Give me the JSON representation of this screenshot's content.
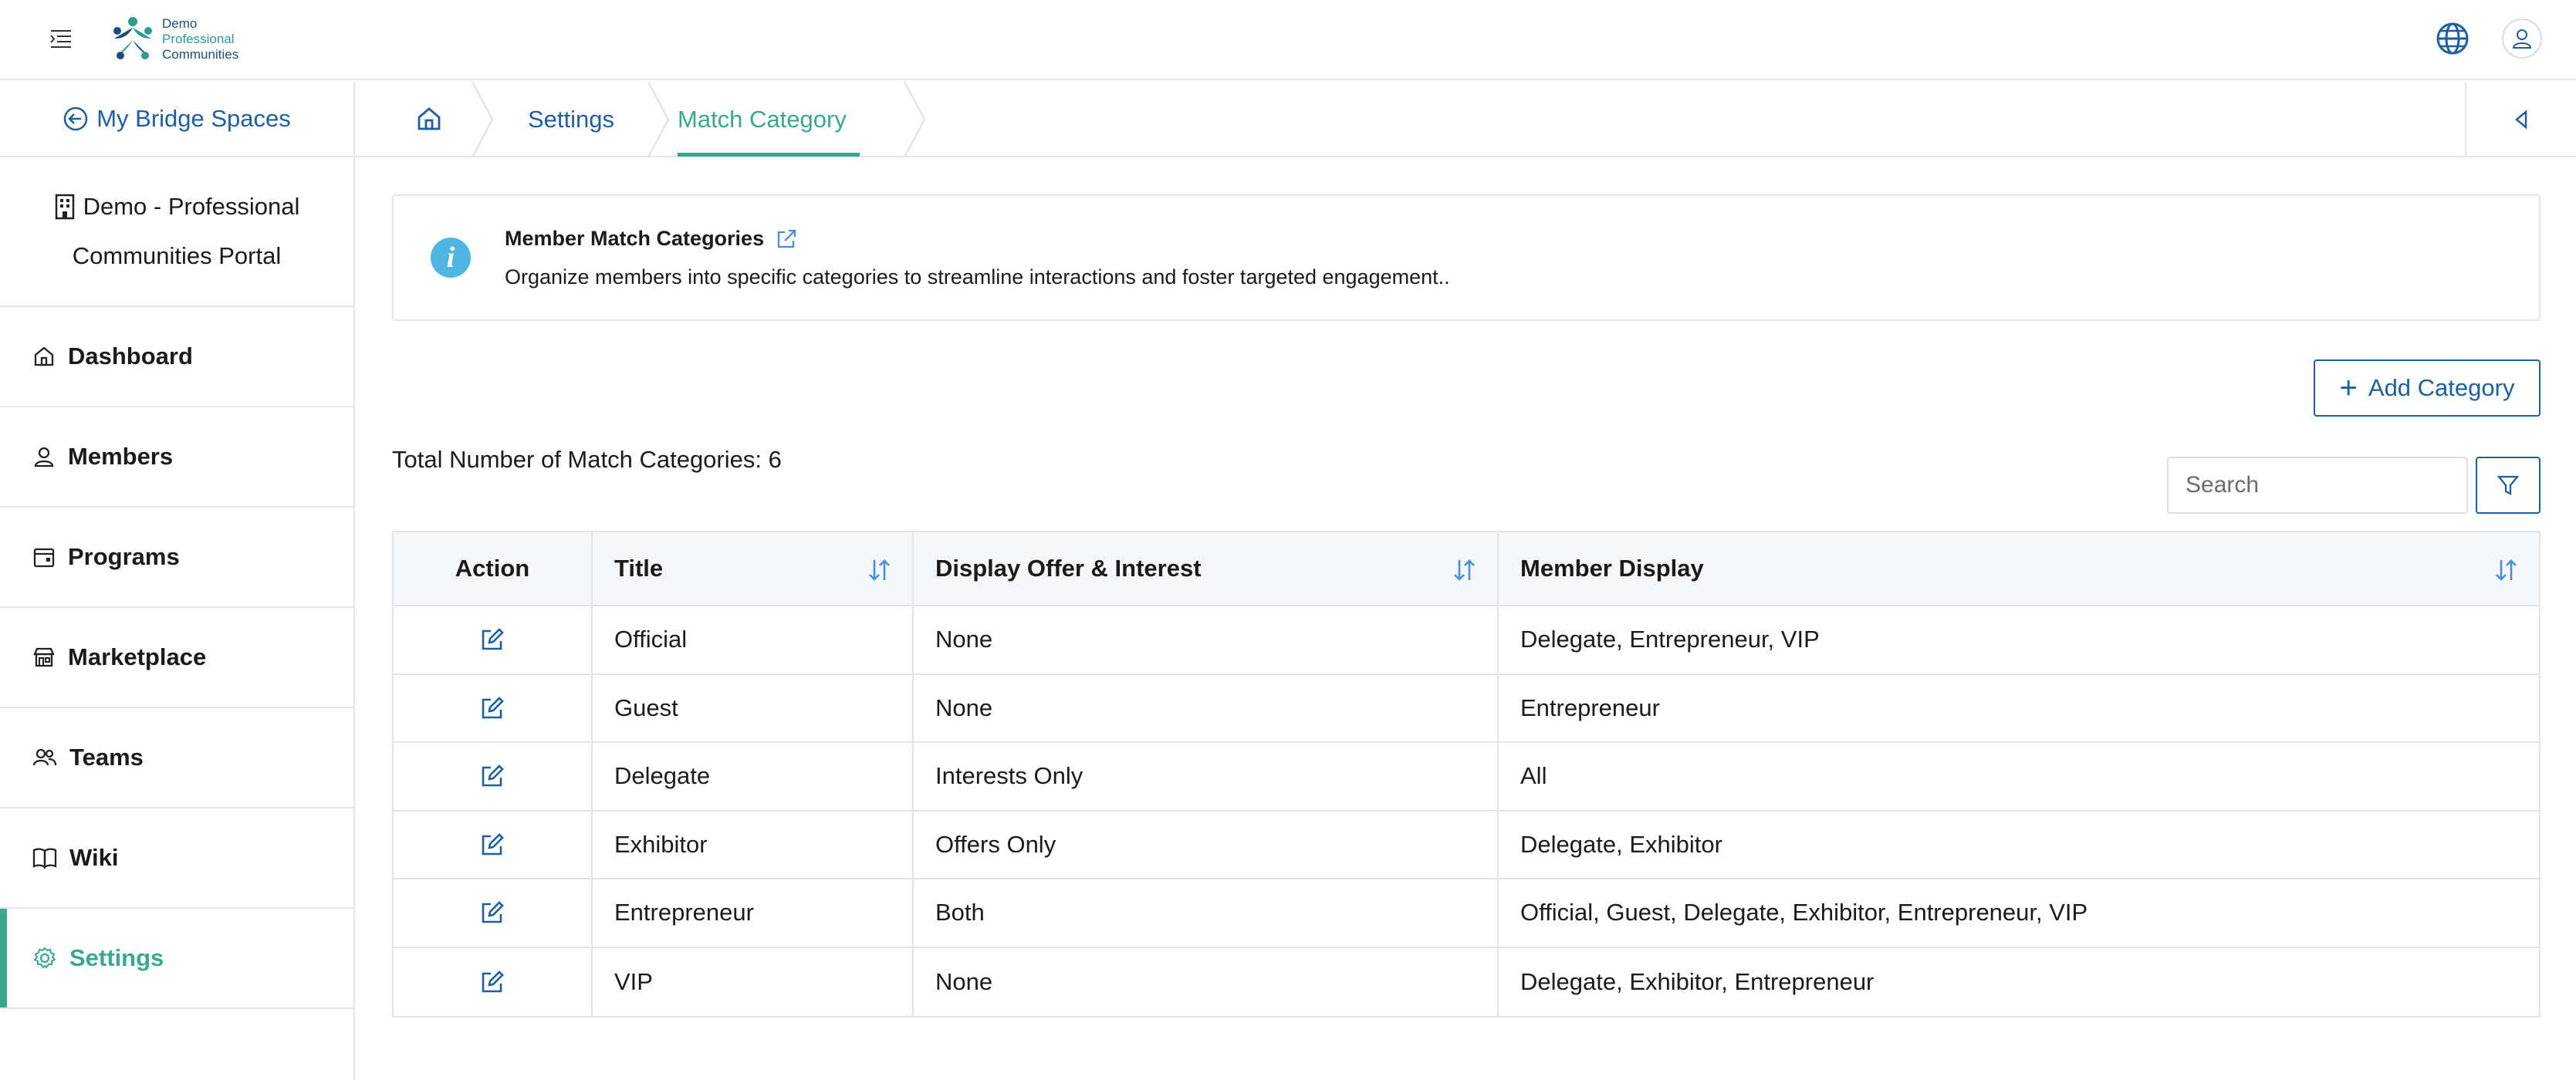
{
  "header": {
    "logo": {
      "line1": "Demo",
      "line2": "Professional",
      "line3": "Communities"
    },
    "icons": [
      "menu-toggle-icon",
      "globe-icon",
      "user-icon"
    ]
  },
  "sidebar": {
    "back_label": "My Bridge Spaces",
    "org_line1": "Demo - Professional",
    "org_line2": "Communities Portal",
    "items": [
      {
        "label": "Dashboard",
        "icon": "home-icon"
      },
      {
        "label": "Members",
        "icon": "person-icon"
      },
      {
        "label": "Programs",
        "icon": "calendar-icon"
      },
      {
        "label": "Marketplace",
        "icon": "store-icon"
      },
      {
        "label": "Teams",
        "icon": "team-icon"
      },
      {
        "label": "Wiki",
        "icon": "book-icon"
      },
      {
        "label": "Settings",
        "icon": "gear-icon",
        "active": true
      }
    ]
  },
  "breadcrumb": {
    "items": [
      "Settings",
      "Match Category"
    ]
  },
  "info": {
    "title": "Member Match Categories",
    "description": "Organize members into specific categories to streamline interactions and foster targeted engagement.."
  },
  "toolbar": {
    "add_label": "Add Category",
    "total_text": "Total Number of Match Categories: 6",
    "search_placeholder": "Search"
  },
  "table": {
    "columns": [
      "Action",
      "Title",
      "Display Offer & Interest",
      "Member Display"
    ],
    "rows": [
      {
        "title": "Official",
        "display": "None",
        "member_display": "Delegate, Entrepreneur, VIP"
      },
      {
        "title": "Guest",
        "display": "None",
        "member_display": "Entrepreneur"
      },
      {
        "title": "Delegate",
        "display": "Interests Only",
        "member_display": "All"
      },
      {
        "title": "Exhibitor",
        "display": "Offers Only",
        "member_display": "Delegate, Exhibitor"
      },
      {
        "title": "Entrepreneur",
        "display": "Both",
        "member_display": "Official, Guest, Delegate, Exhibitor, Entrepreneur, VIP"
      },
      {
        "title": "VIP",
        "display": "None",
        "member_display": "Delegate, Exhibitor, Entrepreneur"
      }
    ]
  },
  "colors": {
    "brand_blue": "#1f5fa0",
    "accent_green": "#3aa88f",
    "info_blue": "#4fb6e3"
  }
}
